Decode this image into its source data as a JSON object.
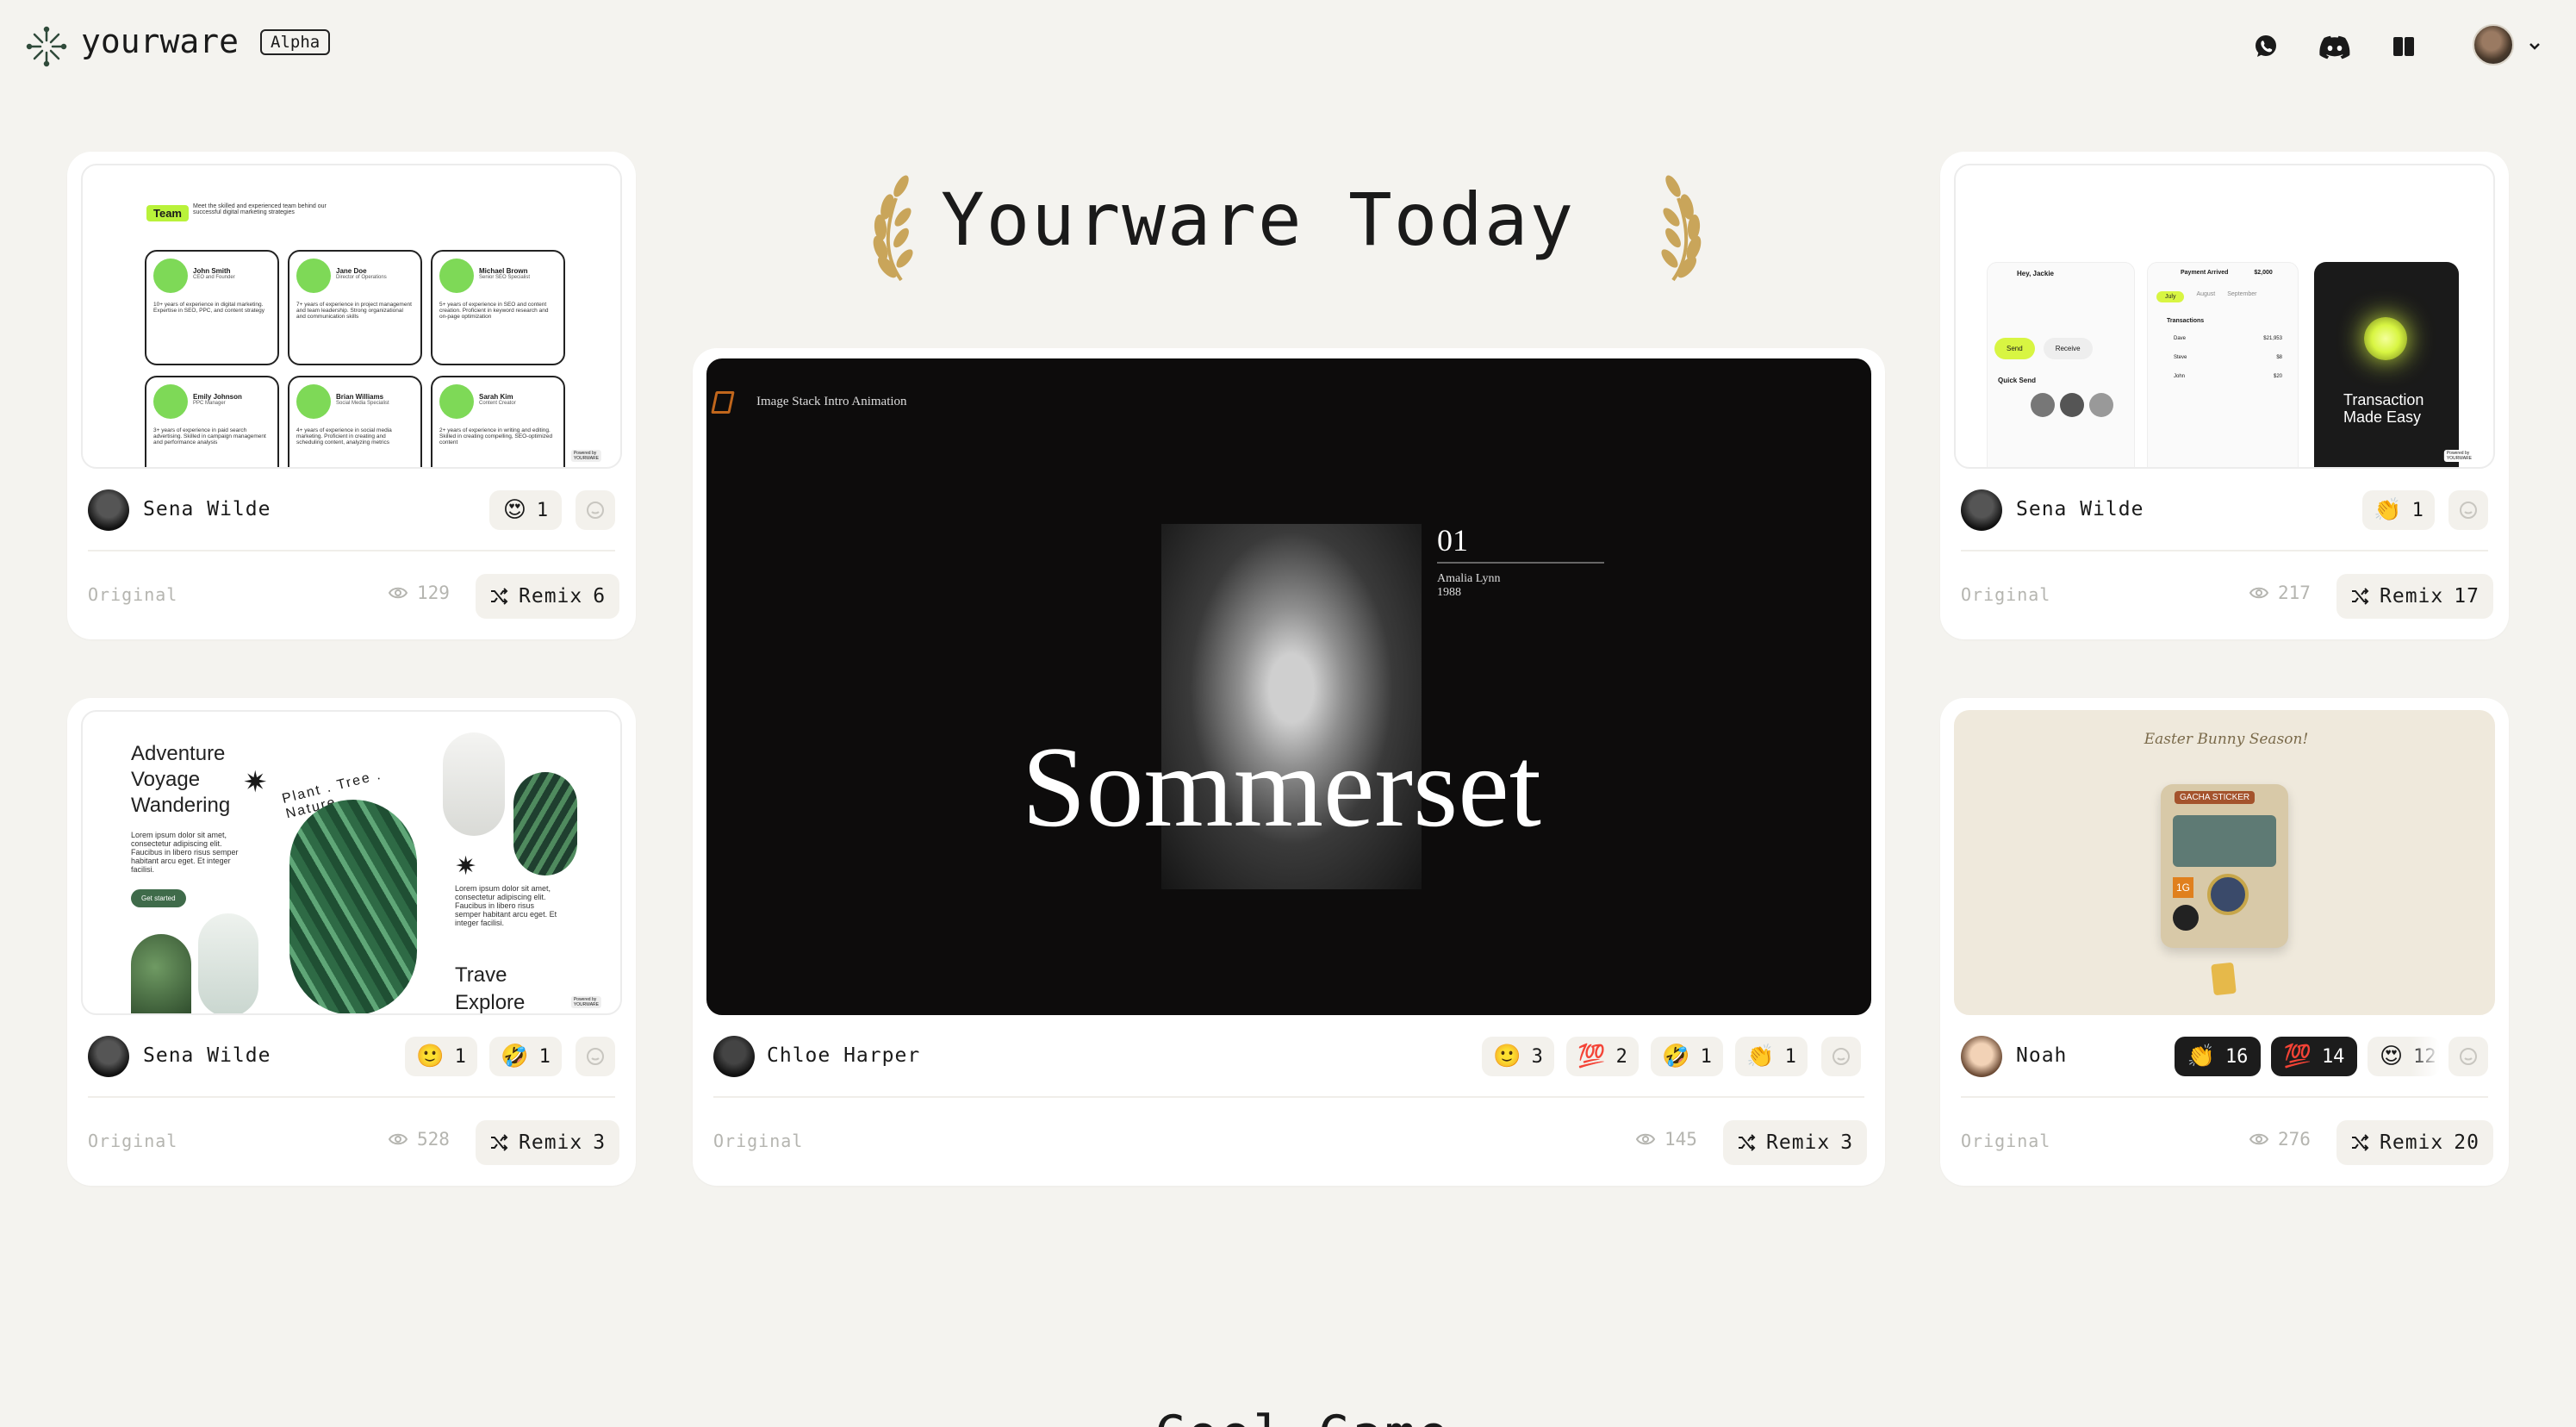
{
  "app": {
    "name": "yourware",
    "badge": "Alpha"
  },
  "header": {
    "title": "Yourware Today",
    "icons": [
      "whatsapp-icon",
      "discord-icon",
      "book-icon",
      "avatar",
      "chevron-down-icon"
    ]
  },
  "colors": {
    "background": "#f4f3ef",
    "card": "#ffffff",
    "laurel": "#c9a55a",
    "accent_green": "#b9f23a"
  },
  "cards": [
    {
      "id": "team",
      "author": "Sena Wilde",
      "reactions": [
        {
          "emoji": "😍",
          "count": "1"
        }
      ],
      "original": "Original",
      "views": "129",
      "remix_label": "Remix",
      "remix_count": "6",
      "preview": {
        "tag": "Team",
        "intro": "Meet the skilled and experienced team behind our successful digital marketing strategies",
        "members": [
          {
            "name": "John Smith",
            "role": "CEO and Founder",
            "bio": "10+ years of experience in digital marketing. Expertise in SEO, PPC, and content strategy"
          },
          {
            "name": "Jane Doe",
            "role": "Director of Operations",
            "bio": "7+ years of experience in project management and team leadership. Strong organizational and communication skills"
          },
          {
            "name": "Michael Brown",
            "role": "Senior SEO Specialist",
            "bio": "5+ years of experience in SEO and content creation. Proficient in keyword research and on-page optimization"
          },
          {
            "name": "Emily Johnson",
            "role": "PPC Manager",
            "bio": "3+ years of experience in paid search advertising. Skilled in campaign management and performance analysis"
          },
          {
            "name": "Brian Williams",
            "role": "Social Media Specialist",
            "bio": "4+ years of experience in social media marketing. Proficient in creating and scheduling content, analyzing metrics"
          },
          {
            "name": "Sarah Kim",
            "role": "Content Creator",
            "bio": "2+ years of experience in writing and editing. Skilled in creating compelling, SEO-optimized content"
          }
        ],
        "powered": "Powered by YOURWARE"
      }
    },
    {
      "id": "adventure",
      "author": "Sena Wilde",
      "reactions": [
        {
          "emoji": "🙂",
          "count": "1"
        },
        {
          "emoji": "🤣",
          "count": "1"
        }
      ],
      "original": "Original",
      "views": "528",
      "remix_label": "Remix",
      "remix_count": "3",
      "preview": {
        "heading": [
          "Adventure",
          "Voyage",
          "Wandering"
        ],
        "lorem": "Lorem ipsum dolor sit amet, consectetur adipiscing elit. Faucibus in libero risus semper habitant arcu eget. Et integer facilisi.",
        "cta": "Get started",
        "arc": "Plant . Tree . Nature",
        "lorem2": "Lorem ipsum dolor sit amet, consectetur adipiscing elit. Faucibus in libero risus semper habitant arcu eget. Et integer facilisi.",
        "travel": [
          "Trave",
          "Explore"
        ],
        "powered": "Powered by YOURWARE"
      }
    },
    {
      "id": "sommerset",
      "author": "Chloe Harper",
      "reactions": [
        {
          "emoji": "🙂",
          "count": "3"
        },
        {
          "emoji": "💯",
          "count": "2"
        },
        {
          "emoji": "🤣",
          "count": "1"
        },
        {
          "emoji": "👏",
          "count": "1"
        }
      ],
      "original": "Original",
      "views": "145",
      "remix_label": "Remix",
      "remix_count": "3",
      "preview": {
        "caption": "Image Stack Intro Animation",
        "index": "01",
        "person": "Amalia Lynn",
        "year": "1988",
        "headline": "Sommerset"
      }
    },
    {
      "id": "finance",
      "author": "Sena Wilde",
      "reactions": [
        {
          "emoji": "👏",
          "count": "1"
        }
      ],
      "original": "Original",
      "views": "217",
      "remix_label": "Remix",
      "remix_count": "17",
      "preview": {
        "greet": "Hey, Jackie",
        "payment": "Payment Arrived",
        "amount": "$2,000",
        "months": [
          "July",
          "August",
          "September"
        ],
        "send": "Send",
        "receive": "Receive",
        "quick": "Quick Send",
        "transactions": "Transactions",
        "tx": [
          {
            "name": "Dave",
            "amt": "$21,953"
          },
          {
            "name": "Steve",
            "amt": "$8"
          },
          {
            "name": "John",
            "amt": "$20"
          }
        ],
        "promo": "Transaction Made Easy",
        "powered": "Powered by YOURWARE"
      }
    },
    {
      "id": "easter",
      "author": "Noah",
      "reactions": [
        {
          "emoji": "👏",
          "count": "16",
          "dark": true
        },
        {
          "emoji": "💯",
          "count": "14",
          "dark": true
        },
        {
          "emoji": "😍",
          "count": "12"
        }
      ],
      "original": "Original",
      "views": "276",
      "remix_label": "Remix",
      "remix_count": "20",
      "preview": {
        "title": "Easter Bunny Season!",
        "machine": "GACHA STICKER",
        "number": "1G"
      }
    }
  ],
  "next_section": {
    "title": "Cool Game"
  }
}
